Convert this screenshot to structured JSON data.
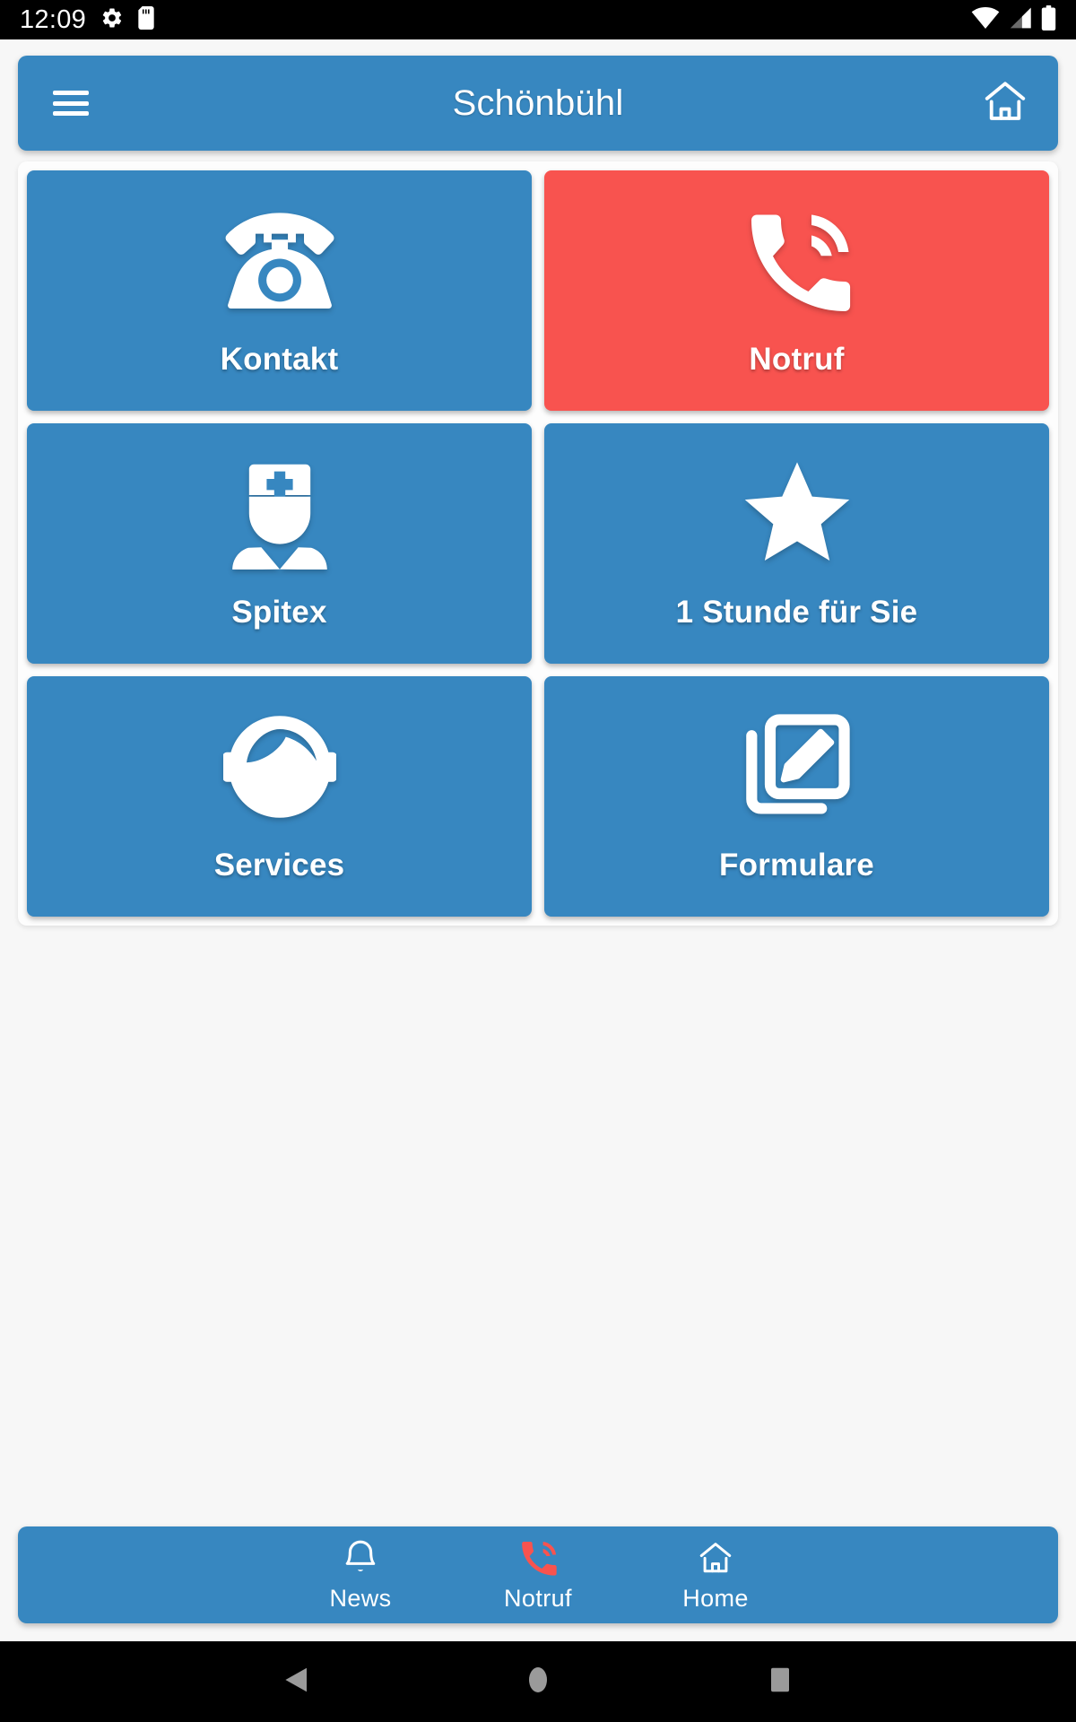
{
  "status_bar": {
    "time": "12:09",
    "left_icons": [
      "gear-icon",
      "sd-card-icon"
    ],
    "right_icons": [
      "wifi-icon",
      "cellular-signal-icon",
      "battery-icon"
    ]
  },
  "app_bar": {
    "menu_icon": "hamburger-menu-icon",
    "title": "Schönbühl",
    "home_icon": "home-icon"
  },
  "colors": {
    "primary": "#3787C0",
    "danger": "#F8534F",
    "page_background": "#F7F7F7",
    "card_background": "#FDFDFD",
    "on_primary": "#FFFFFF"
  },
  "grid": {
    "tiles": [
      {
        "label": "Kontakt",
        "icon": "desk-phone-icon",
        "style": "primary"
      },
      {
        "label": "Notruf",
        "icon": "phone-in-talk-icon",
        "style": "danger"
      },
      {
        "label": "Spitex",
        "icon": "nurse-icon",
        "style": "primary"
      },
      {
        "label": "1 Stunde für Sie",
        "icon": "star-icon",
        "style": "primary"
      },
      {
        "label": "Services",
        "icon": "support-agent-icon",
        "style": "primary"
      },
      {
        "label": "Formulare",
        "icon": "edit-document-icon",
        "style": "primary"
      }
    ]
  },
  "bottom_nav": {
    "items": [
      {
        "label": "News",
        "icon": "bell-icon",
        "style": "normal"
      },
      {
        "label": "Notruf",
        "icon": "phone-in-talk-icon",
        "style": "alert"
      },
      {
        "label": "Home",
        "icon": "home-outline-icon",
        "style": "normal"
      }
    ]
  },
  "android_nav": {
    "back": "back-triangle-icon",
    "home": "home-circle-icon",
    "recents": "recents-square-icon"
  }
}
